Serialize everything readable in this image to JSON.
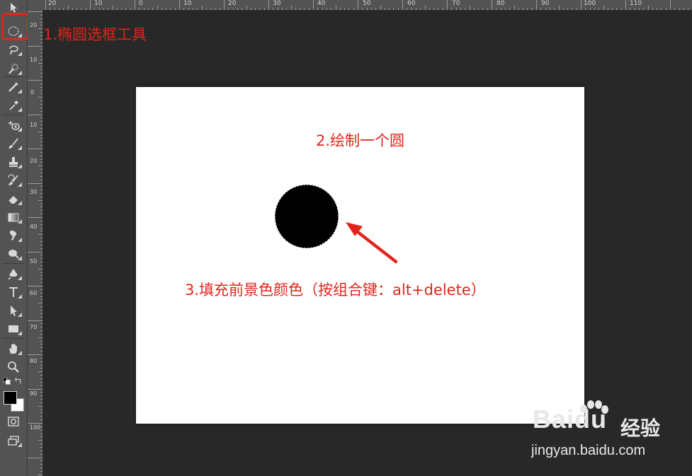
{
  "canvas": {
    "background": "#ffffff",
    "fill_color": "#000000"
  },
  "annotations": {
    "step1": "1.椭圆选框工具",
    "step2": "2.绘制一个圆",
    "step3": "3.填充前景色颜色（按组合键：alt+delete）",
    "color": "#e1251b"
  },
  "ruler_top": {
    "labels": [
      "20",
      "10",
      "0",
      "10",
      "20",
      "30",
      "40",
      "50",
      "60",
      "70",
      "80",
      "90",
      "100",
      "110"
    ]
  },
  "ruler_left": {
    "labels": [
      "20",
      "10",
      "0",
      "10",
      "20",
      "30",
      "40",
      "50",
      "60",
      "70",
      "80",
      "90",
      "100"
    ]
  },
  "tools": [
    "move-icon",
    "elliptical-marquee-icon",
    "lasso-icon",
    "quick-selection-icon",
    "crop-icon",
    "eyedropper-icon",
    "spot-healing-icon",
    "brush-icon",
    "clone-stamp-icon",
    "history-brush-icon",
    "eraser-icon",
    "gradient-icon",
    "blur-icon",
    "dodge-icon",
    "pen-icon",
    "type-icon",
    "path-selection-icon",
    "rectangle-icon",
    "hand-icon",
    "zoom-icon"
  ],
  "swatches": {
    "foreground": "#000000",
    "background": "#ffffff"
  },
  "watermark": {
    "brand": "Baidu",
    "product": "经验",
    "url": "jingyan.baidu.com"
  }
}
